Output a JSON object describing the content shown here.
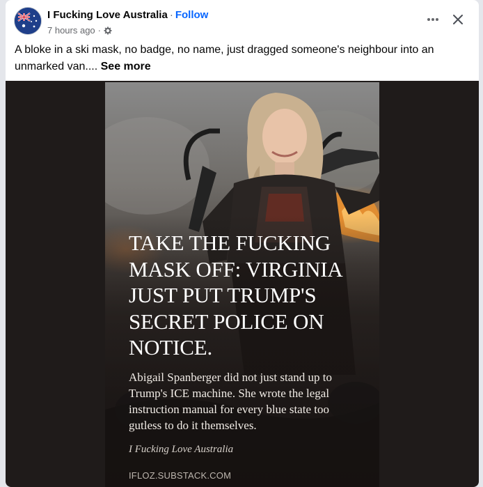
{
  "post": {
    "page_name": "I Fucking Love Australia",
    "separator": "·",
    "follow_label": "Follow",
    "timestamp": "7 hours ago",
    "meta_separator": "·",
    "audience_icon": "gear-icon",
    "text": "A bloke in a ski mask, no badge, no name, just dragged someone's neighbour into an unmarked van.... ",
    "see_more_label": "See more"
  },
  "header_actions": {
    "more_icon": "more-dots-icon",
    "close_icon": "close-icon"
  },
  "image": {
    "headline": "Take the fucking mask off: Virginia just put Trump's secret police on notice.",
    "subtext": "Abigail Spanberger did not just stand up to Trump's ICE machine. She wrote the legal instruction manual for every blue state too gutless to do it themselves.",
    "byline": "I Fucking Love Australia",
    "source": "IFLOZ.SUBSTACK.COM"
  },
  "colors": {
    "link_blue": "#0866ff",
    "text_primary": "#050505",
    "text_secondary": "#65676b",
    "media_bg": "#1f1b1a"
  }
}
